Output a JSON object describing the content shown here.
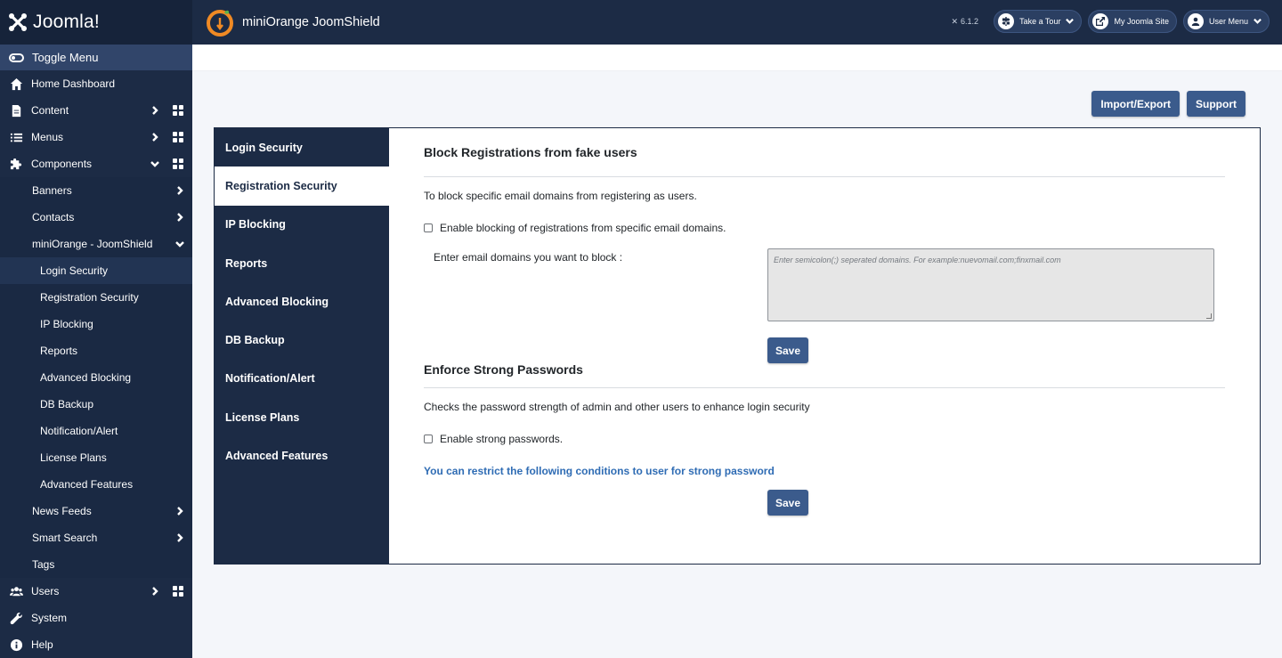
{
  "brand": {
    "name": "Joomla!"
  },
  "sidebar": {
    "toggle_label": "Toggle Menu",
    "items": [
      {
        "label": "Home Dashboard",
        "icon": "home-icon"
      },
      {
        "label": "Content",
        "icon": "file-icon"
      },
      {
        "label": "Menus",
        "icon": "list-icon"
      },
      {
        "label": "Components",
        "icon": "puzzle-icon"
      },
      {
        "label": "Users",
        "icon": "users-icon"
      },
      {
        "label": "System",
        "icon": "wrench-icon"
      },
      {
        "label": "Help",
        "icon": "info-icon"
      }
    ],
    "components": [
      "Banners",
      "Contacts",
      "miniOrange - JoomShield",
      "News Feeds",
      "Smart Search",
      "Tags"
    ],
    "joomshield_items": [
      "Login Security",
      "Registration Security",
      "IP Blocking",
      "Reports",
      "Advanced Blocking",
      "DB Backup",
      "Notification/Alert",
      "License Plans",
      "Advanced Features"
    ]
  },
  "header": {
    "title": "miniOrange JoomShield",
    "version": "6.1.2",
    "take_tour": "Take a Tour",
    "my_site": "My Joomla Site",
    "user_menu": "User Menu"
  },
  "actions": {
    "import_export": "Import/Export",
    "support": "Support"
  },
  "tabs": [
    "Login Security",
    "Registration Security",
    "IP Blocking",
    "Reports",
    "Advanced Blocking",
    "DB Backup",
    "Notification/Alert",
    "License Plans",
    "Advanced Features"
  ],
  "block_section": {
    "title": "Block Registrations from fake users",
    "description": "To block specific email domains from registering as users.",
    "checkbox_label": "Enable blocking of registrations from specific email domains.",
    "domain_label": "Enter email domains you want to block :",
    "domain_placeholder": "Enter semicolon(;) seperated domains. For example:nuevomail.com;finxmail.com",
    "save": "Save"
  },
  "password_section": {
    "title": "Enforce Strong Passwords",
    "description": "Checks the password strength of admin and other users to enhance login security",
    "checkbox_label": "Enable strong passwords.",
    "note": "You can restrict the following conditions to user for strong password",
    "save": "Save"
  },
  "colors": {
    "sidebar_bg": "#1c2b45",
    "button": "#3b5b8c",
    "link": "#2f6cb4",
    "accent_orange": "#f08a24"
  }
}
